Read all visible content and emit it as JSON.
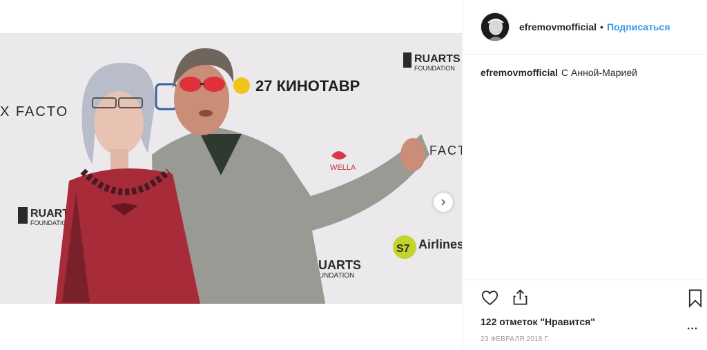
{
  "post": {
    "username": "efremovmofficial",
    "separator": "•",
    "follow_label": "Подписаться",
    "caption_user": "efremovmofficial",
    "caption_text": "С Анной-Марией",
    "likes_text": "122 отметок \"Нравится\"",
    "date_text": "23 февраля 2018 г.",
    "more_label": "..."
  },
  "photo": {
    "backdrop_texts": [
      "27 КИНОТАВР",
      "RUARTS",
      "FOUNDATION",
      "X FACTO",
      "FACTO",
      "WELLA",
      "Airlines",
      "S7"
    ],
    "carousel_dots": 3,
    "active_dot": 0
  },
  "icons": [
    "heart-icon",
    "share-icon",
    "bookmark-icon",
    "chevron-right-icon"
  ],
  "colors": {
    "link": "#3897f0",
    "text": "#262626",
    "muted": "#999999",
    "border": "#efefef"
  }
}
